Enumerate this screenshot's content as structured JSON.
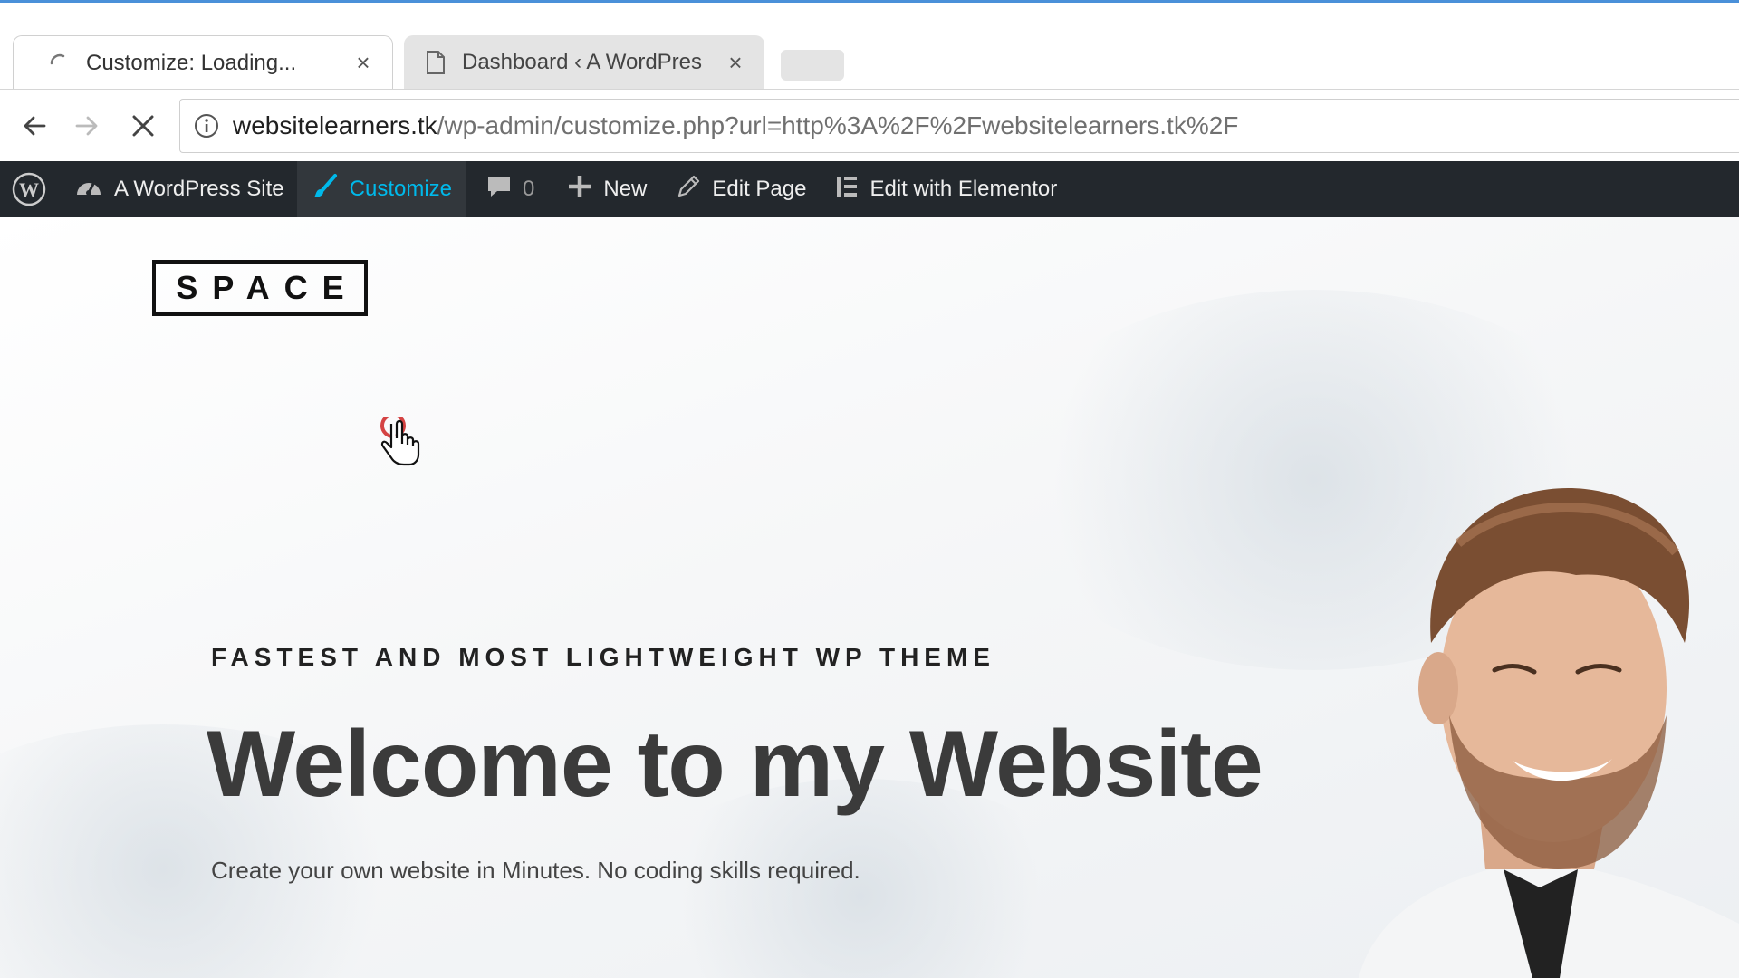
{
  "browser": {
    "tabs": [
      {
        "title": "Customize: Loading...",
        "close": "×",
        "icon": "loading-spinner-icon"
      },
      {
        "title": "Dashboard ‹ A WordPres",
        "close": "×",
        "icon": "document-icon"
      }
    ],
    "url_host": "websitelearners.tk",
    "url_path": "/wp-admin/customize.php?url=http%3A%2F%2Fwebsitelearners.tk%2F"
  },
  "adminbar": {
    "site_name": "A WordPress Site",
    "customize": "Customize",
    "comments_count": "0",
    "new": "New",
    "edit_page": "Edit Page",
    "edit_elementor": "Edit with Elementor"
  },
  "page": {
    "logo": "SPACE",
    "eyebrow": "FASTEST AND MOST LIGHTWEIGHT WP THEME",
    "headline": "Welcome to my Website",
    "subline": "Create your own website in Minutes. No coding skills required."
  },
  "colors": {
    "adminbar_bg": "#23282d",
    "adminbar_active": "#00b9eb",
    "progress": "#4a90d9"
  }
}
